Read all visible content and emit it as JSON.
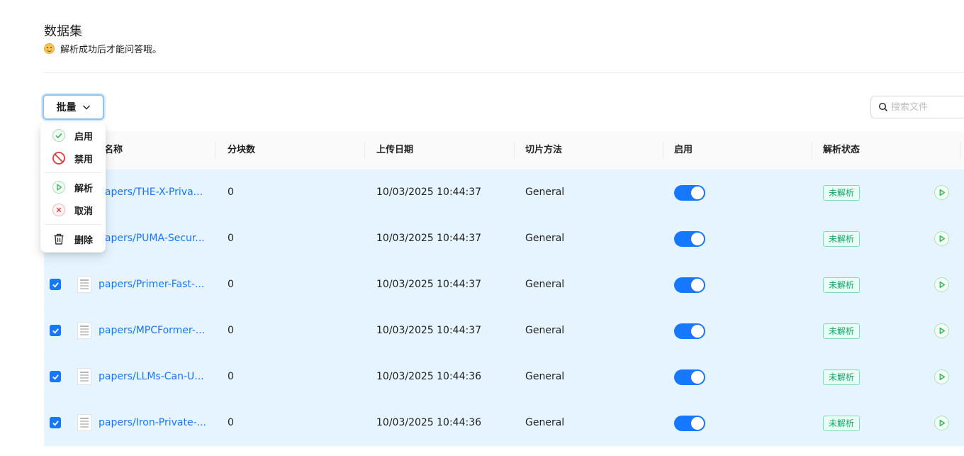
{
  "header": {
    "title": "数据集",
    "subtitle": "解析成功后才能问答哦。"
  },
  "toolbar": {
    "batch_label": "批量",
    "search_placeholder": "搜索文件"
  },
  "dropdown": {
    "items": [
      {
        "label": "启用",
        "icon": "check-circle-icon"
      },
      {
        "label": "禁用",
        "icon": "ban-icon"
      },
      {
        "label": "解析",
        "icon": "play-circle-icon"
      },
      {
        "label": "取消",
        "icon": "x-circle-icon"
      },
      {
        "label": "删除",
        "icon": "trash-icon"
      }
    ]
  },
  "table": {
    "columns": [
      "名称",
      "分块数",
      "上传日期",
      "切片方法",
      "启用",
      "解析状态"
    ],
    "rows": [
      {
        "name": "papers/THE-X-Priva...",
        "chunks": "0",
        "date": "10/03/2025 10:44:37",
        "method": "General",
        "enabled": true,
        "status": "未解析",
        "checked": true
      },
      {
        "name": "papers/PUMA-Secur...",
        "chunks": "0",
        "date": "10/03/2025 10:44:37",
        "method": "General",
        "enabled": true,
        "status": "未解析",
        "checked": true
      },
      {
        "name": "papers/Primer-Fast-...",
        "chunks": "0",
        "date": "10/03/2025 10:44:37",
        "method": "General",
        "enabled": true,
        "status": "未解析",
        "checked": true
      },
      {
        "name": "papers/MPCFormer-...",
        "chunks": "0",
        "date": "10/03/2025 10:44:37",
        "method": "General",
        "enabled": true,
        "status": "未解析",
        "checked": true
      },
      {
        "name": "papers/LLMs-Can-U...",
        "chunks": "0",
        "date": "10/03/2025 10:44:36",
        "method": "General",
        "enabled": true,
        "status": "未解析",
        "checked": true
      },
      {
        "name": "papers/Iron-Private-...",
        "chunks": "0",
        "date": "10/03/2025 10:44:36",
        "method": "General",
        "enabled": true,
        "status": "未解析",
        "checked": true
      }
    ]
  },
  "colors": {
    "accent": "#1677ff",
    "row_selected": "#e6f4ff",
    "status_green": "#13a46b"
  }
}
